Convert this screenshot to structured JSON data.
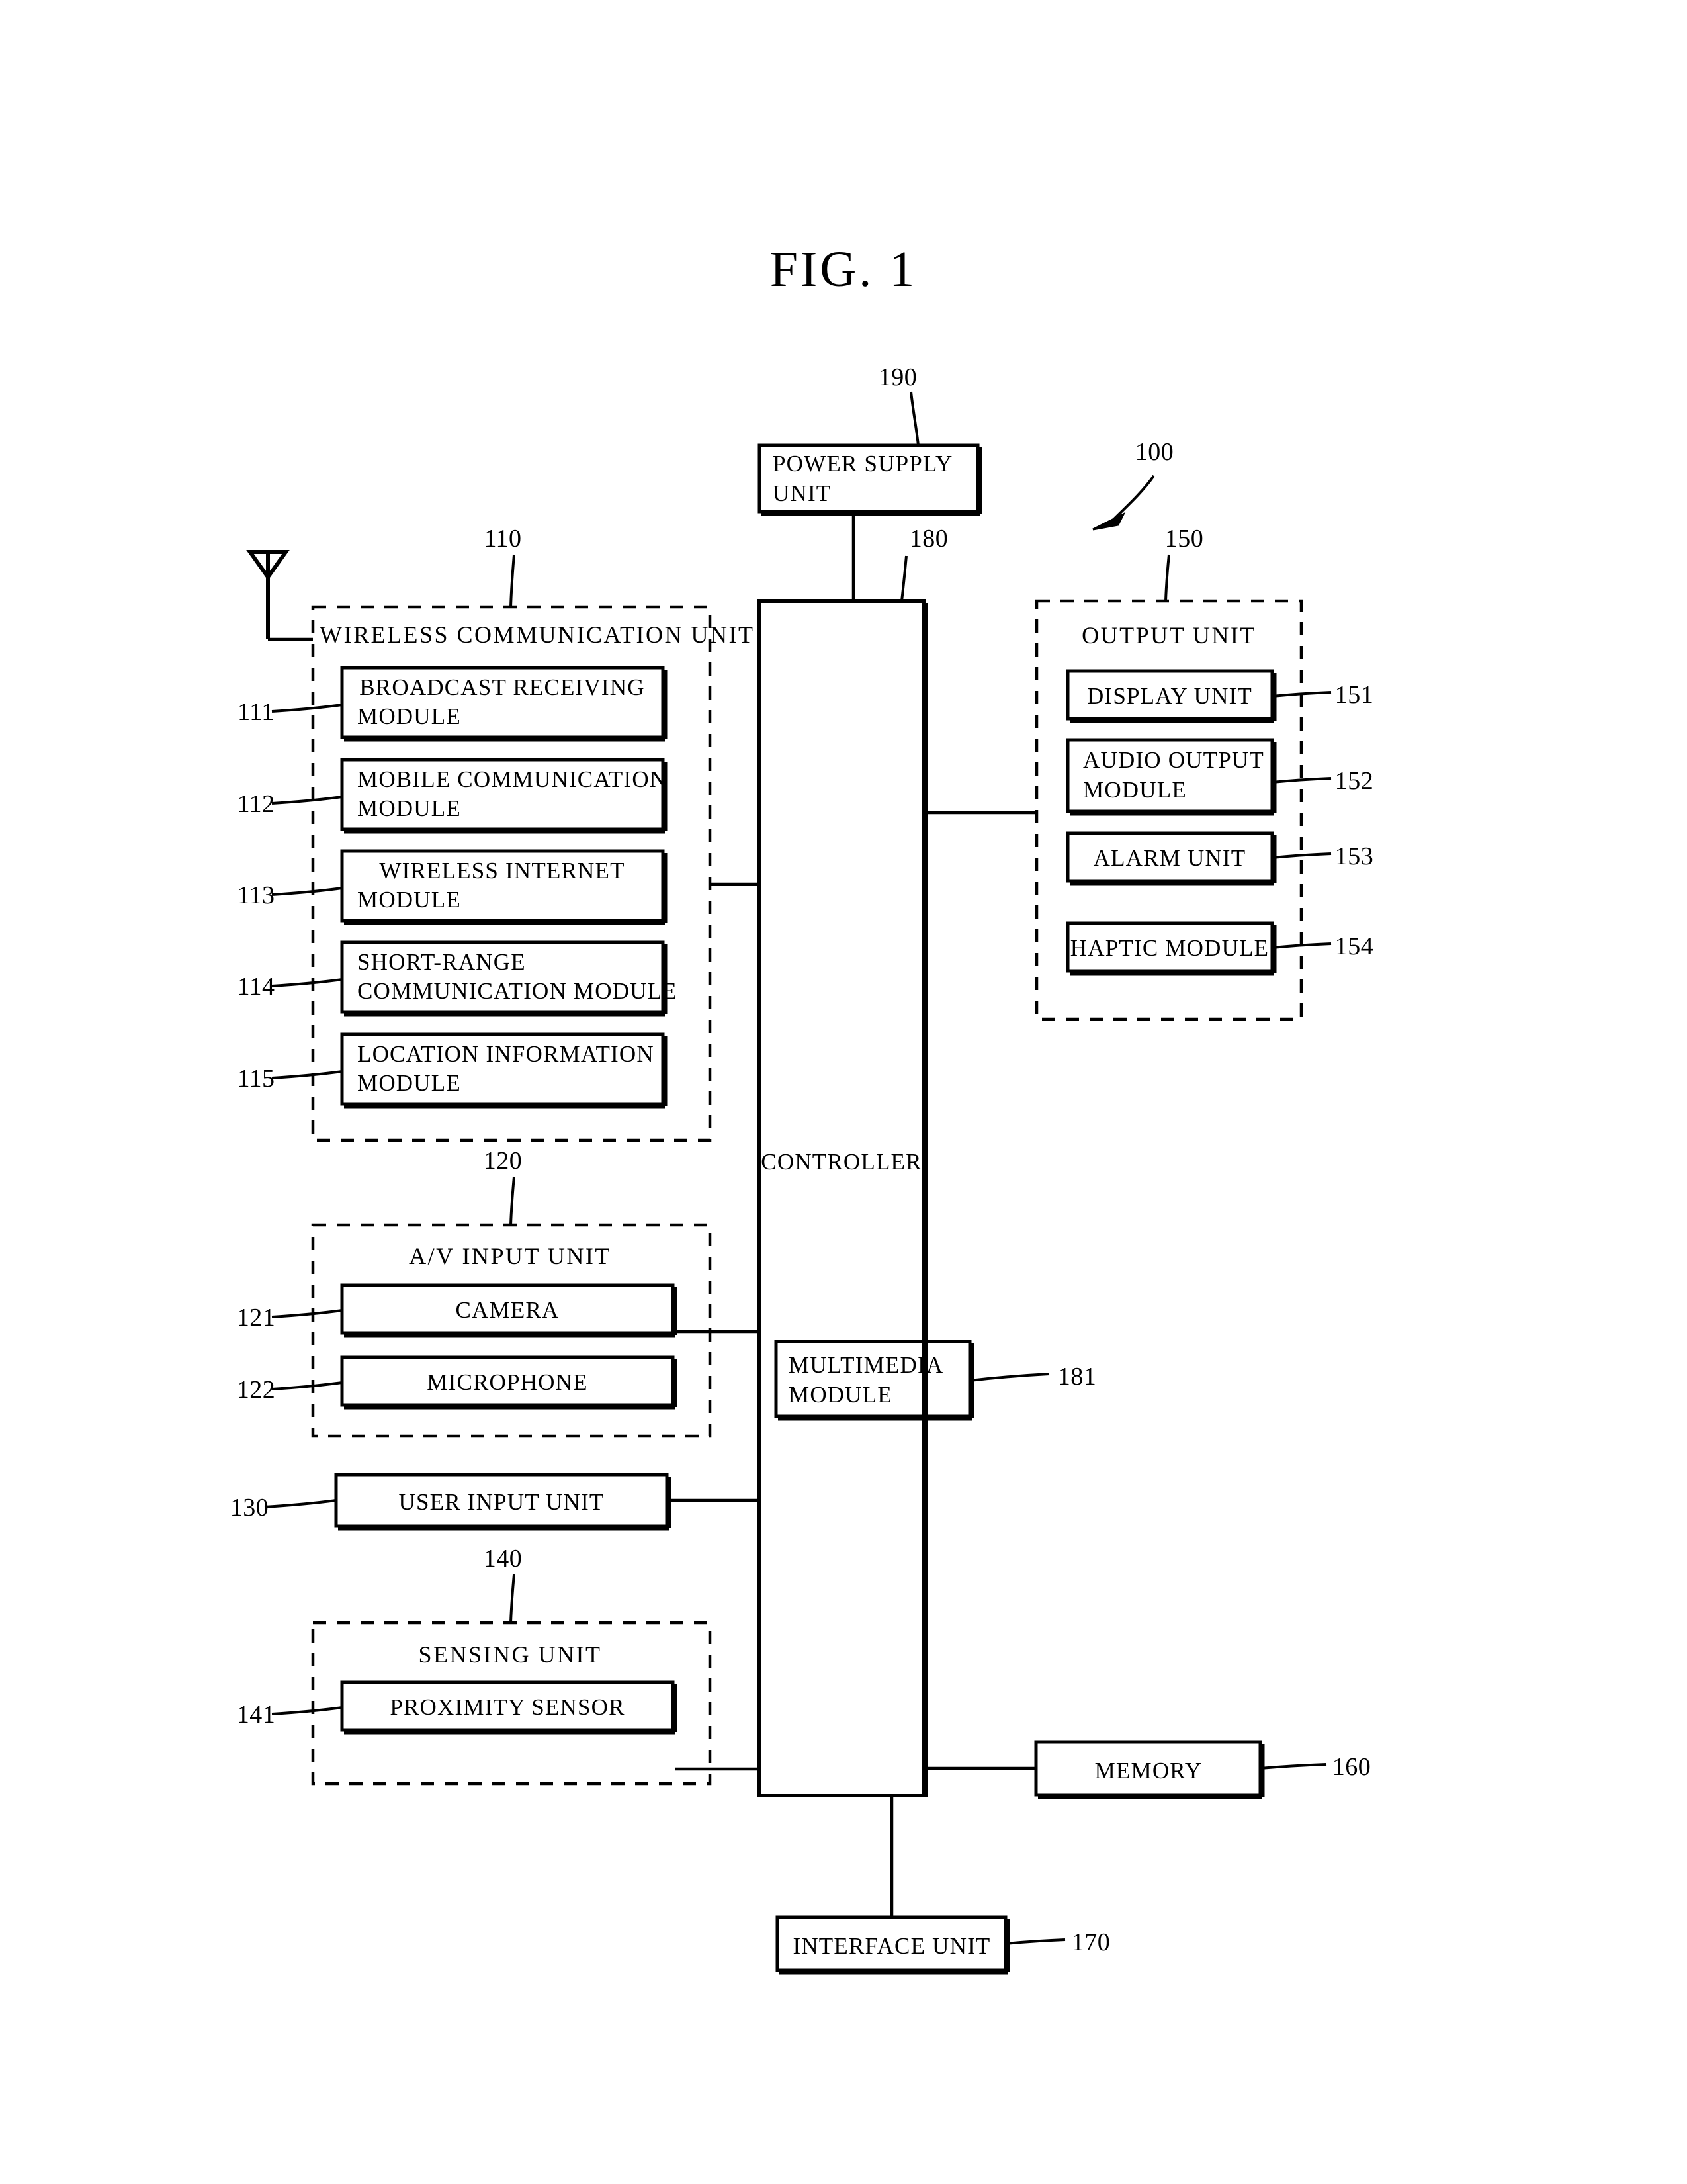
{
  "figure": {
    "title": "FIG.  1",
    "system_ref": "100"
  },
  "blocks": {
    "power_supply": {
      "label_line1": "POWER SUPPLY",
      "label_line2": "UNIT",
      "ref": "190"
    },
    "controller": {
      "label": "CONTROLLER",
      "ref": "180"
    },
    "multimedia": {
      "label_line1": "MULTIMEDIA",
      "label_line2": "MODULE",
      "ref": "181"
    },
    "memory": {
      "label": "MEMORY",
      "ref": "160"
    },
    "interface": {
      "label": "INTERFACE UNIT",
      "ref": "170"
    },
    "user_input": {
      "label": "USER INPUT UNIT",
      "ref": "130"
    }
  },
  "wireless_unit": {
    "title": "WIRELESS COMMUNICATION UNIT",
    "ref": "110",
    "modules": [
      {
        "ref": "111",
        "line1": "BROADCAST RECEIVING",
        "line2": "MODULE",
        "align": "center"
      },
      {
        "ref": "112",
        "line1": "MOBILE COMMUNICATION",
        "line2": "MODULE",
        "align": "left"
      },
      {
        "ref": "113",
        "line1": "WIRELESS INTERNET",
        "line2": "MODULE",
        "align": "center"
      },
      {
        "ref": "114",
        "line1": "SHORT-RANGE",
        "line2": "COMMUNICATION MODULE",
        "align": "left"
      },
      {
        "ref": "115",
        "line1": "LOCATION INFORMATION",
        "line2": "MODULE",
        "align": "left"
      }
    ]
  },
  "av_input_unit": {
    "title": "A/V INPUT UNIT",
    "ref": "120",
    "modules": [
      {
        "ref": "121",
        "label": "CAMERA"
      },
      {
        "ref": "122",
        "label": "MICROPHONE"
      }
    ]
  },
  "sensing_unit": {
    "title": "SENSING UNIT",
    "ref": "140",
    "modules": [
      {
        "ref": "141",
        "label": "PROXIMITY SENSOR"
      }
    ]
  },
  "output_unit": {
    "title": "OUTPUT UNIT",
    "ref": "150",
    "modules": [
      {
        "ref": "151",
        "line1": "DISPLAY UNIT",
        "line2": "",
        "align": "center"
      },
      {
        "ref": "152",
        "line1": "AUDIO OUTPUT",
        "line2": "MODULE",
        "align": "left"
      },
      {
        "ref": "153",
        "line1": "ALARM UNIT",
        "line2": "",
        "align": "center"
      },
      {
        "ref": "154",
        "line1": "HAPTIC MODULE",
        "line2": "",
        "align": "center"
      }
    ]
  },
  "icons": {
    "antenna": "antenna-icon"
  },
  "colors": {
    "stroke": "#000000",
    "background": "#ffffff"
  }
}
